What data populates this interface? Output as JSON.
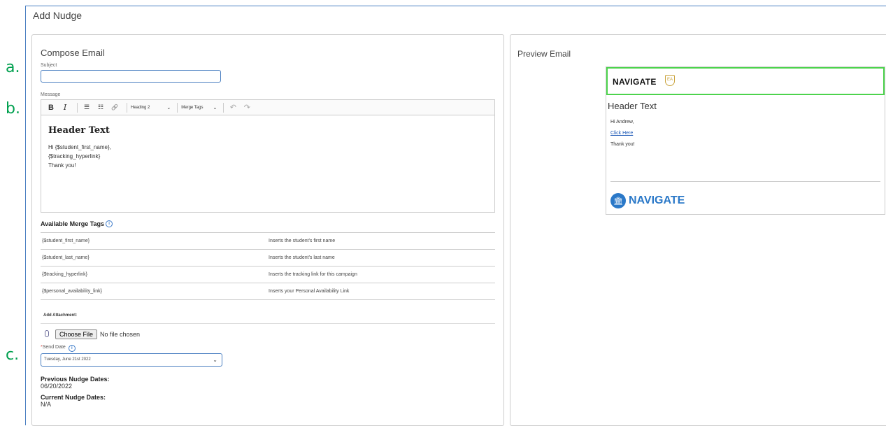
{
  "annotations": {
    "a": "a.",
    "b": "b.",
    "c": "c."
  },
  "modal": {
    "title": "Add Nudge"
  },
  "compose": {
    "title": "Compose Email",
    "subject_label": "Subject",
    "subject_value": "",
    "message_label": "Message",
    "toolbar": {
      "bold": "B",
      "italic": "I",
      "bulleted": "☰",
      "numbered": "☷",
      "link": "🔗",
      "heading": "Heading 2",
      "merge": "Merge Tags",
      "undo": "↶",
      "redo": "↷",
      "chevron": "⌄"
    },
    "editor": {
      "heading": "Header Text",
      "lines": [
        "Hi {$student_first_name},",
        "{$tracking_hyperlink}",
        "Thank you!"
      ]
    },
    "merge_tags_title": "Available Merge Tags",
    "merge_tags": [
      {
        "tag": "{$student_first_name}",
        "desc": "Inserts the student's first name"
      },
      {
        "tag": "{$student_last_name}",
        "desc": "Inserts the student's last name"
      },
      {
        "tag": "{$tracking_hyperlink}",
        "desc": "Inserts the tracking link for this campaign"
      },
      {
        "tag": "{$personal_availability_link}",
        "desc": "Inserts your Personal Availability Link"
      }
    ],
    "attachment_label": "Add Attachment:",
    "choose_file": "Choose File",
    "no_file": "No file chosen",
    "required_mark": "*",
    "send_date_label": "Send Date",
    "send_date_value": "Tuesday, June 21st 2022",
    "previous_title": "Previous Nudge Dates:",
    "previous_value": "06/20/2022",
    "current_title": "Current Nudge Dates:",
    "current_value": "N/A"
  },
  "preview": {
    "title": "Preview Email",
    "logo_text": "NAVIGATE",
    "shield_text": "EA",
    "heading": "Header Text",
    "greeting": "Hi Andrew,",
    "link": "Click Here",
    "thanks": "Thank you!",
    "footer_logo": "NAVIGATE",
    "footer_icon": "🏛"
  },
  "colors": {
    "accent": "#4a7fc1",
    "annotation": "#00a04f",
    "preview_border": "#4dd34d",
    "navigate_blue": "#2a78c8"
  }
}
